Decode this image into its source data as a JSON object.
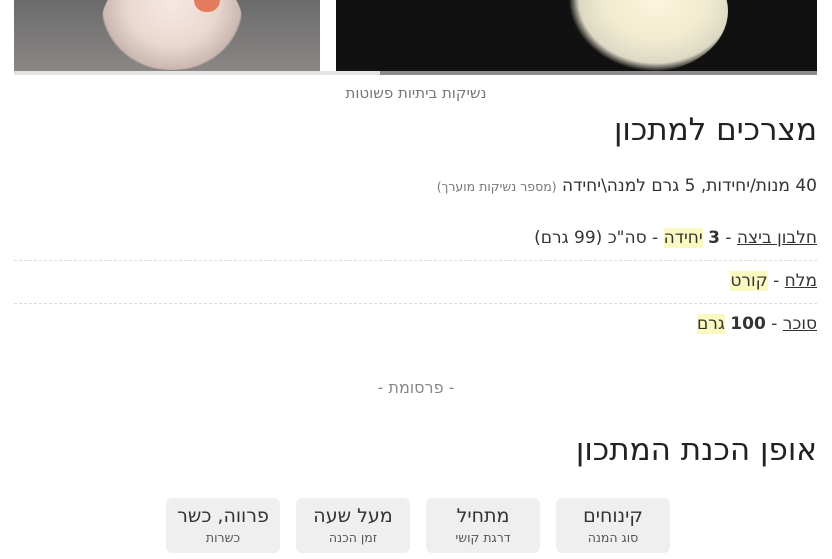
{
  "gallery": {
    "caption": "נשיקות ביתיות פשוטות"
  },
  "ingredients": {
    "title": "מצרכים למתכון",
    "servings": "40 מנות/יחידות, 5 גרם למנה\\יחידה",
    "servings_note": "(מספר נשיקות מוערך)",
    "items": [
      {
        "name": "חלבון ביצה",
        "sep1": " - ",
        "qty": "3",
        "space": " ",
        "unit": "יחידה",
        "sep2": " - ",
        "total": "סה\"כ (99 גרם)"
      },
      {
        "name": "מלח",
        "sep1": " - ",
        "unit": "קורט"
      },
      {
        "name": "סוכר",
        "sep1": " - ",
        "qty": "100",
        "space": " ",
        "unit": "גרם"
      }
    ]
  },
  "ad_label": "- פרסומת -",
  "method": {
    "title": "אופן הכנת המתכון"
  },
  "meta": [
    {
      "value": "קינוחים",
      "label": "סוג המנה"
    },
    {
      "value": "מתחיל",
      "label": "דרגת קושי"
    },
    {
      "value": "מעל שעה",
      "label": "זמן הכנה"
    },
    {
      "value": "פרווה, כשר",
      "label": "כשרות"
    }
  ],
  "colors": {
    "highlight": "#fbf9c2",
    "chip_bg": "#efefef",
    "scroll_thumb": "#8c8c8c"
  }
}
